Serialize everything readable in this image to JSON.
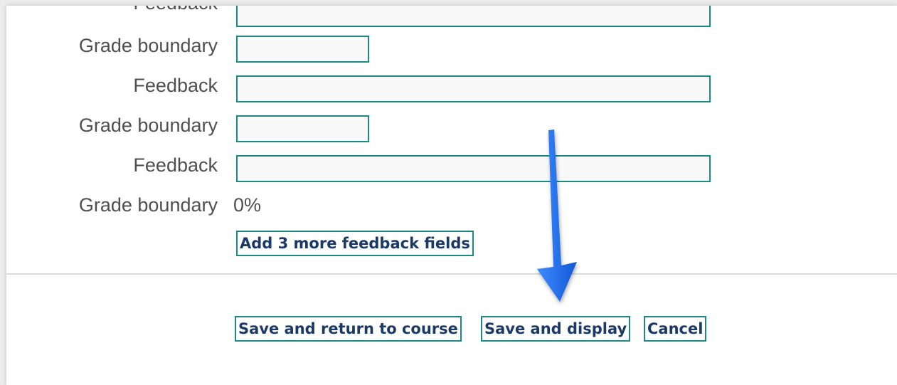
{
  "form": {
    "feedback_label": "Feedback",
    "grade_boundary_label": "Grade boundary",
    "last_grade_boundary_value": "0%",
    "add_more_label": "Add 3 more feedback fields"
  },
  "actions": {
    "save_return_label": "Save and return to course",
    "save_display_label": "Save and display",
    "cancel_label": "Cancel"
  },
  "colors": {
    "field_border": "#1b8a87",
    "button_text": "#1a3966",
    "arrow": "#1f6ff0"
  },
  "annotation": {
    "icon": "down-arrow-icon"
  }
}
